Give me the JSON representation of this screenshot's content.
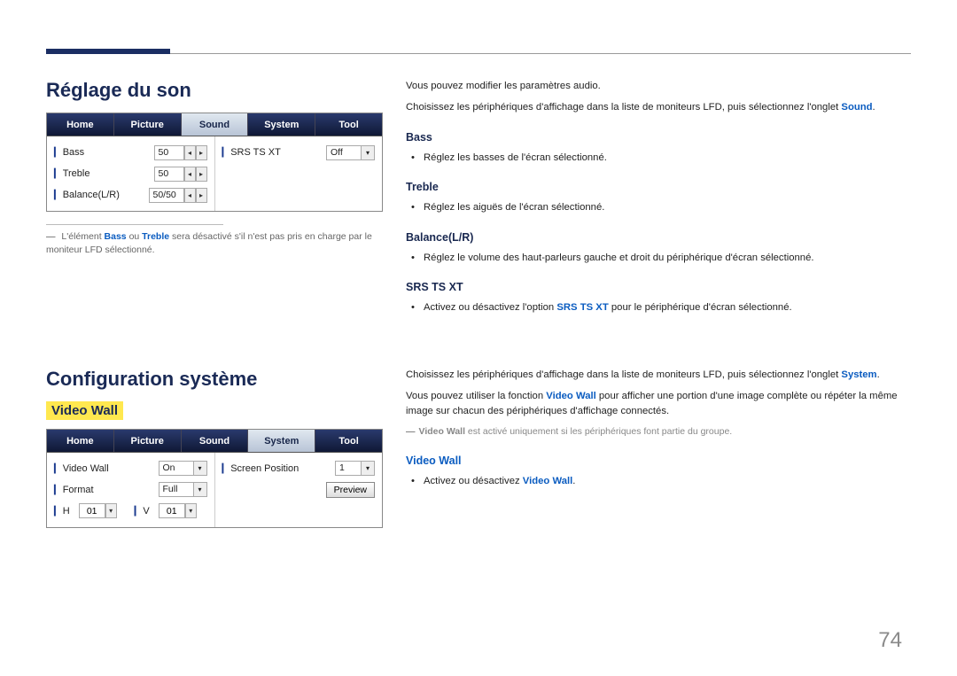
{
  "page_number": "74",
  "left": {
    "section1_title": "Réglage du son",
    "section2_title": "Configuration système",
    "video_wall_heading": "Video Wall",
    "note": {
      "pre": "L'élément ",
      "b1": "Bass",
      "mid": " ou ",
      "b2": "Treble",
      "post": " sera désactivé s'il n'est pas pris en charge par le moniteur LFD sélectionné."
    }
  },
  "right": {
    "intro1": "Vous pouvez modifier les paramètres audio.",
    "intro2_pre": "Choisissez les périphériques d'affichage dans la liste de moniteurs LFD, puis sélectionnez l'onglet ",
    "intro2_bold": "Sound",
    "intro2_post": ".",
    "bass_h": "Bass",
    "bass_li": "Réglez les basses de l'écran sélectionné.",
    "treble_h": "Treble",
    "treble_li": "Réglez les aiguës de l'écran sélectionné.",
    "balance_h": "Balance(L/R)",
    "balance_li": "Réglez le volume des haut-parleurs gauche et droit du périphérique d'écran sélectionné.",
    "srs_h": "SRS TS XT",
    "srs_li_pre": "Activez ou désactivez l'option ",
    "srs_li_bold": "SRS TS XT",
    "srs_li_post": " pour le périphérique d'écran sélectionné.",
    "sys1_pre": "Choisissez les périphériques d'affichage dans la liste de moniteurs LFD, puis sélectionnez l'onglet ",
    "sys1_bold": "System",
    "sys1_post": ".",
    "sys2_pre": "Vous pouvez utiliser la fonction ",
    "sys2_bold": "Video Wall",
    "sys2_post": " pour afficher une portion d'une image complète ou répéter la même image sur chacun des périphériques d'affichage connectés.",
    "sys_note_bold": "Video Wall",
    "sys_note_post": " est activé uniquement si les périphériques font partie du groupe.",
    "vw_h": "Video Wall",
    "vw_li_pre": "Activez ou désactivez ",
    "vw_li_bold": "Video Wall",
    "vw_li_post": "."
  },
  "panel_sound": {
    "tabs": [
      "Home",
      "Picture",
      "Sound",
      "System",
      "Tool"
    ],
    "active_tab_index": 2,
    "rows": {
      "bass": {
        "label": "Bass",
        "value": "50"
      },
      "treble": {
        "label": "Treble",
        "value": "50"
      },
      "balance": {
        "label": "Balance(L/R)",
        "value": "50/50"
      },
      "srs": {
        "label": "SRS TS XT",
        "value": "Off"
      }
    }
  },
  "panel_system": {
    "tabs": [
      "Home",
      "Picture",
      "Sound",
      "System",
      "Tool"
    ],
    "active_tab_index": 3,
    "rows": {
      "video_wall": {
        "label": "Video Wall",
        "value": "On"
      },
      "format": {
        "label": "Format",
        "value": "Full"
      },
      "h": {
        "label": "H",
        "value": "01"
      },
      "v": {
        "label": "V",
        "value": "01"
      },
      "screen_pos": {
        "label": "Screen Position",
        "value": "1"
      },
      "preview_btn": "Preview"
    }
  }
}
